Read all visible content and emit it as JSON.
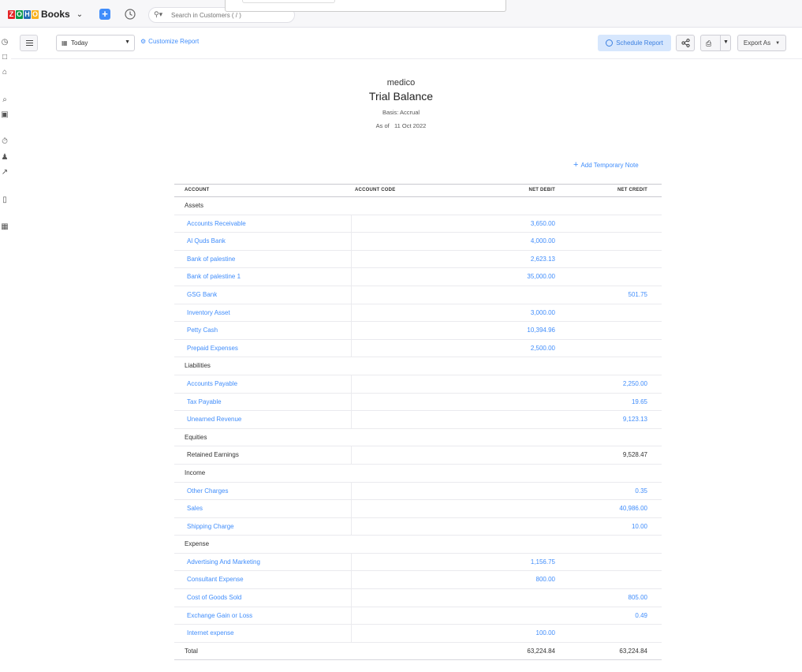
{
  "app": {
    "brand": "Books",
    "logo_letters": [
      "Z",
      "O",
      "H",
      "O"
    ],
    "logo_colors": [
      "#e42527",
      "#089949",
      "#226db4",
      "#f9b21d"
    ],
    "search_placeholder": "Search in Customers ( / )"
  },
  "toolbar": {
    "date_filter": "Today",
    "customize_label": "Customize Report",
    "schedule_label": "Schedule Report",
    "export_label": "Export As"
  },
  "report": {
    "organization": "medico",
    "title": "Trial Balance",
    "basis": "Basis: Accrual",
    "as_of_label": "As of",
    "as_of_date": "11 Oct 2022",
    "add_note_label": "Add Temporary Note"
  },
  "table": {
    "headers": {
      "account": "ACCOUNT",
      "code": "ACCOUNT CODE",
      "debit": "NET DEBIT",
      "credit": "NET CREDIT"
    },
    "groups": [
      {
        "name": "Assets",
        "rows": [
          {
            "account": "Accounts Receivable",
            "debit": "3,650.00",
            "credit": "",
            "link": true
          },
          {
            "account": "Al Quds Bank",
            "debit": "4,000.00",
            "credit": "",
            "link": true
          },
          {
            "account": "Bank of palestine",
            "debit": "2,623.13",
            "credit": "",
            "link": true
          },
          {
            "account": "Bank of palestine 1",
            "debit": "35,000.00",
            "credit": "",
            "link": true
          },
          {
            "account": "GSG Bank",
            "debit": "",
            "credit": "501.75",
            "link": true
          },
          {
            "account": "Inventory Asset",
            "debit": "3,000.00",
            "credit": "",
            "link": true
          },
          {
            "account": "Petty Cash",
            "debit": "10,394.96",
            "credit": "",
            "link": true
          },
          {
            "account": "Prepaid Expenses",
            "debit": "2,500.00",
            "credit": "",
            "link": true
          }
        ]
      },
      {
        "name": "Liabilities",
        "rows": [
          {
            "account": "Accounts Payable",
            "debit": "",
            "credit": "2,250.00",
            "link": true
          },
          {
            "account": "Tax Payable",
            "debit": "",
            "credit": "19.65",
            "link": true
          },
          {
            "account": "Unearned Revenue",
            "debit": "",
            "credit": "9,123.13",
            "link": true
          }
        ]
      },
      {
        "name": "Equities",
        "rows": [
          {
            "account": "Retained Earnings",
            "debit": "",
            "credit": "9,528.47",
            "link": false
          }
        ]
      },
      {
        "name": "Income",
        "rows": [
          {
            "account": "Other Charges",
            "debit": "",
            "credit": "0.35",
            "link": true
          },
          {
            "account": "Sales",
            "debit": "",
            "credit": "40,986.00",
            "link": true
          },
          {
            "account": "Shipping Charge",
            "debit": "",
            "credit": "10.00",
            "link": true
          }
        ]
      },
      {
        "name": "Expense",
        "rows": [
          {
            "account": "Advertising And Marketing",
            "debit": "1,156.75",
            "credit": "",
            "link": true
          },
          {
            "account": "Consultant Expense",
            "debit": "800.00",
            "credit": "",
            "link": true
          },
          {
            "account": "Cost of Goods Sold",
            "debit": "",
            "credit": "805.00",
            "link": true
          },
          {
            "account": "Exchange Gain or Loss",
            "debit": "",
            "credit": "0.49",
            "link": true
          },
          {
            "account": "Internet expense",
            "debit": "100.00",
            "credit": "",
            "link": true
          }
        ]
      }
    ],
    "total": {
      "label": "Total",
      "debit": "63,224.84",
      "credit": "63,224.84"
    }
  },
  "colors": {
    "accent": "#408dfb",
    "schedule_bg": "#d7e7fd"
  }
}
